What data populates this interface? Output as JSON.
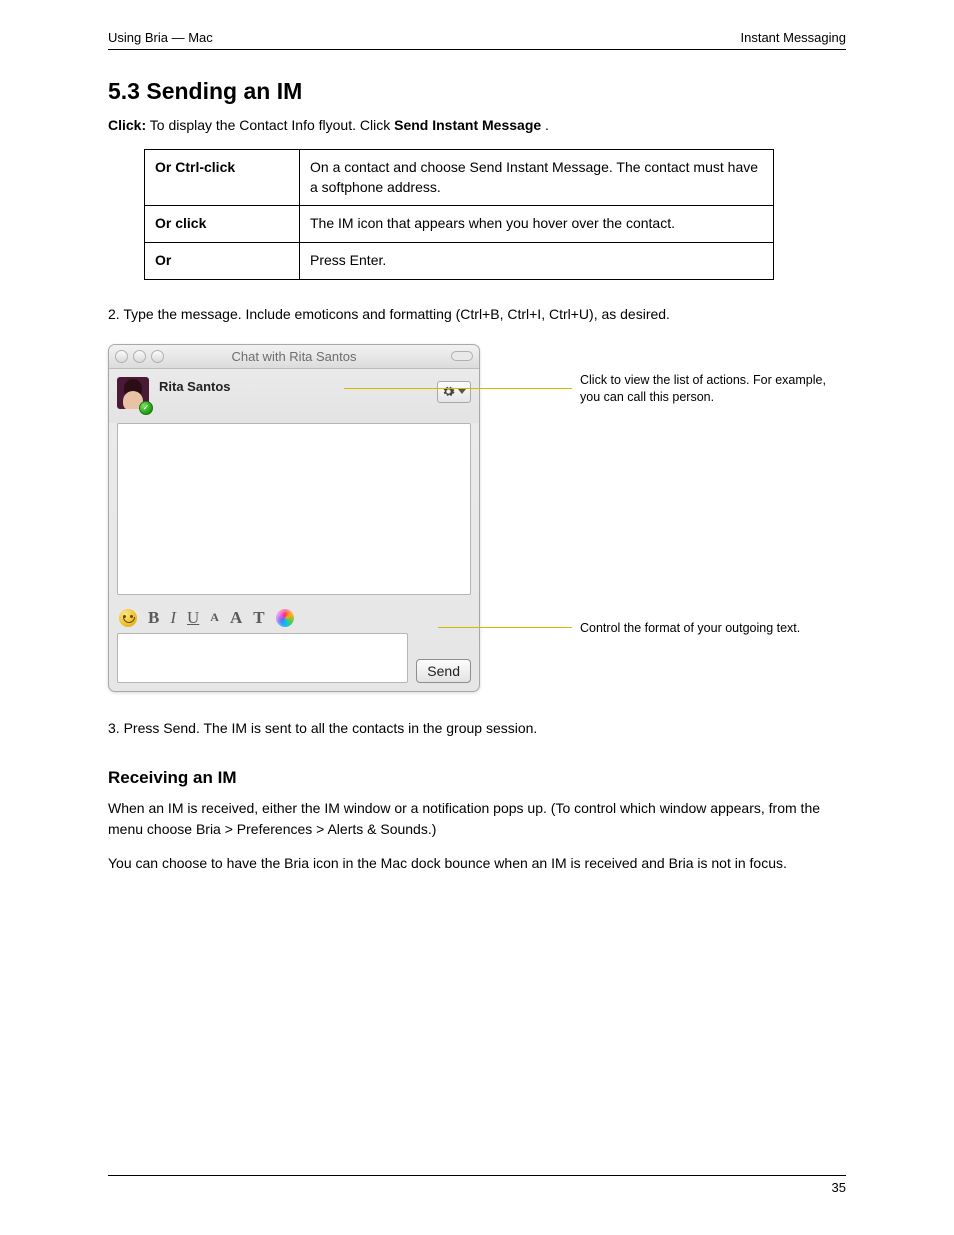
{
  "header": {
    "left": "Using Bria — Mac",
    "right": "Instant Messaging"
  },
  "section_title": "5.3  Sending an IM",
  "intro": {
    "click_label": "Click:",
    "click_desc_a": " To display the Contact Info flyout. Click ",
    "click_desc_b": "Send Instant Message",
    "click_desc_c": "."
  },
  "table": {
    "row1": {
      "l": "Or Ctrl-click",
      "r": "On a contact and choose Send Instant Message. The contact must have a softphone address."
    },
    "row2": {
      "l": "Or click",
      "r": "The IM icon that appears when you hover over the contact."
    },
    "row3": {
      "l": "Or",
      "r": "Press Enter."
    }
  },
  "step2_a": "2.",
  "step2_b": " Type the message. Include emoticons and formatting (Ctrl+B, Ctrl+I, Ctrl+U), as desired.",
  "figure": {
    "window_title": "Chat with Rita Santos",
    "contact_name": "Rita Santos",
    "send_label": "Send",
    "toolbar": {
      "b": "B",
      "i": "I",
      "u": "U",
      "sA": "A",
      "lA": "A",
      "t": "T"
    }
  },
  "callout1": "Click to view the list of actions. For example, you can call this person.",
  "callout2": "Control the format of your outgoing text.",
  "subhead": "Receiving an IM",
  "recv_body_a": "When an IM is received, either the IM window or a notification pops up. (To control which window appears, from the menu choose Bria > Preferences > Alerts & Sounds.)",
  "recv_body_b": "You can choose to have the Bria icon in the Mac dock bounce when an IM is received and Bria is not in focus.",
  "step3_a": "3.",
  "step3_b": " Press Send. The IM is sent to all the contacts in the group session.",
  "footer": {
    "page": "35"
  }
}
